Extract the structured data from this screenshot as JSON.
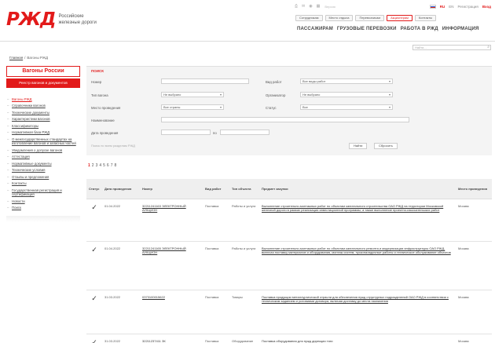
{
  "brand": {
    "logo": "РЖД",
    "line1": "Российские",
    "line2": "железные дороги"
  },
  "top_tools": {
    "label": "Версия",
    "lang_ru": "RU",
    "lang_en": "EN",
    "link1": "Регистрация",
    "link2": "Вход"
  },
  "top_buttons": [
    "Сотрудникам",
    "Место отдыха",
    "Перевозчикам",
    "Акционерам",
    "Контакты"
  ],
  "main_nav": [
    "ПАССАЖИРАМ",
    "ГРУЗОВЫЕ ПЕРЕВОЗКИ",
    "РАБОТА В РЖД",
    "ИНФОРМАЦИЯ"
  ],
  "search": {
    "placeholder": "Найти..."
  },
  "breadcrumb": {
    "home": "Главная",
    "sep": "/",
    "current": "Вагоны РЖД"
  },
  "sidebar": {
    "title": "Вагоны России",
    "button": "Реестр вагонов и документов",
    "items": [
      "Вагоны РЖД",
      "Справочники вагонов",
      "Технические документы",
      "Характеристики вагонов",
      "Классификаторы",
      "Нормативная база РЖД",
      "О межгосударственных стандартах на изготовление вагонов и запасных частей",
      "Уведомления о допуске вагонов",
      "Аттестация",
      "Нормативные документы",
      "Технические условия",
      "Отзывы и предложения",
      "Контакты",
      "Государственная регистрация и сертификация",
      "Новости",
      "Поиск"
    ]
  },
  "form": {
    "title": "ПОИСК",
    "label_number": "Номер",
    "label_type": "Тип вагона",
    "label_owner": "Место проведения",
    "label_full": "Наименование",
    "label_date": "Дата проведения",
    "label_kind": "Вид работ",
    "label_customer": "Организатор",
    "label_status": "Статус",
    "type_value": "Не выбрано",
    "owner_value": "Все страны",
    "kind_value": "Все виды работ",
    "customer_value": "Не выбрано",
    "status_value": "Все",
    "date_sep": "по",
    "note": "Поиск по всем разделам РЖД",
    "btn_search": "Найти",
    "btn_reset": "Сбросить"
  },
  "pager": [
    "1",
    "2",
    "3",
    "4",
    "5",
    "6",
    "7",
    "8"
  ],
  "table": {
    "headers": [
      "Статус",
      "Дата проведения",
      "Номер",
      "Вид работ",
      "Тип объекта",
      "Предмет закупки",
      "Место проведения"
    ],
    "rows": [
      {
        "date": "01.04.2022",
        "num": "32211241163 ЭЛЕКТРОННЫЙ АУКЦИОН",
        "kind": "Поставка",
        "type": "Работы и услуги",
        "subject": "Выполнение строительно-монтажных работ по объектам капитального строительства ОАО РЖД на территории Московской железной дороги в рамках реализации инвестиционной программы, а также выполнение проектно-изыскательских работ",
        "place": "Москва"
      },
      {
        "date": "01.04.2022",
        "num": "32211241165 ЭЛЕКТРОННЫЙ АУКЦИОН",
        "kind": "Поставка",
        "type": "Работы и услуги",
        "subject": "Выполнение строительно-монтажных работ по объектам капитального ремонта и модернизации инфраструктуры ОАО РЖД, включая поставку материалов и оборудования, монтаж систем, пусконаладочные работы и техническое обслуживание объектов",
        "place": "Москва"
      },
      {
        "date": "31.03.2022",
        "num": "0373100015622",
        "kind": "Поставка",
        "type": "Товары",
        "subject": "Поставка продукции металлургической отрасли для обеспечения нужд структурных подразделений ОАО РЖД в соответствии с техническим заданием и условиями договора, включая доставку до места назначения",
        "place": "Москва"
      },
      {
        "date": "31.03.2022",
        "num": "32211237411 ЗК",
        "kind": "Поставка",
        "type": "Оборудование",
        "subject": "Поставка оборудования для нужд дирекции тяги",
        "place": "Москва"
      }
    ]
  }
}
